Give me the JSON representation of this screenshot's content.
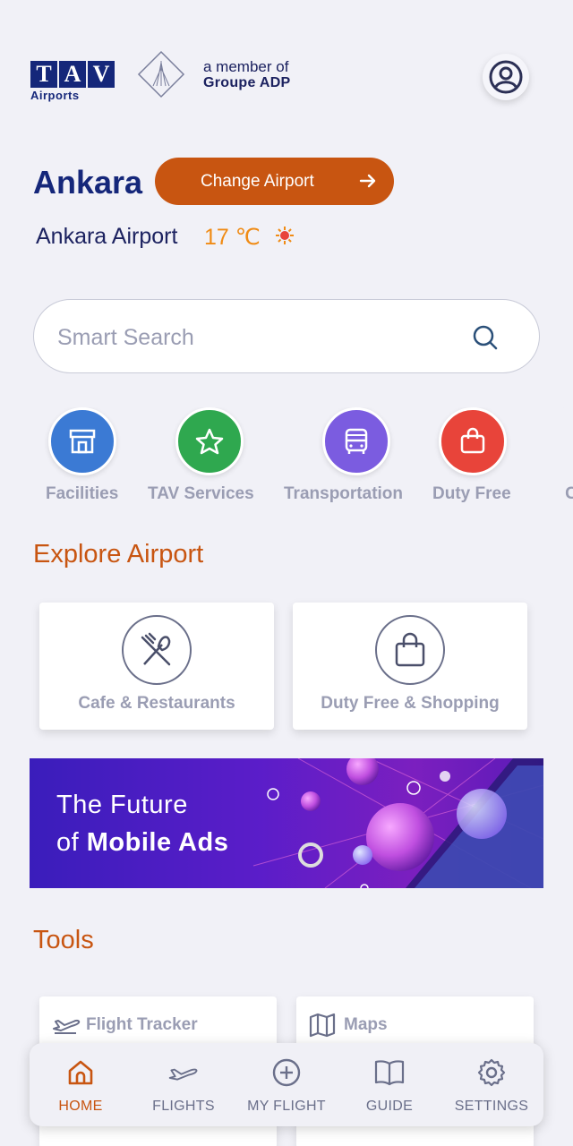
{
  "header": {
    "logo_letters": [
      "T",
      "A",
      "V"
    ],
    "logo_sub": "Airports",
    "member_line1": "a member of",
    "member_line2": "Groupe ADP"
  },
  "location": {
    "city": "Ankara",
    "change_label": "Change Airport",
    "airport": "Ankara Airport",
    "temperature": "17 ℃",
    "weather_icon": "sun-icon"
  },
  "search": {
    "placeholder": "Smart Search"
  },
  "categories": [
    {
      "label": "Facilities",
      "icon": "storefront-icon",
      "color": "#3b7ad4"
    },
    {
      "label": "TAV Services",
      "icon": "star-icon",
      "color": "#2fa84f"
    },
    {
      "label": "Transportation",
      "icon": "bus-icon",
      "color": "#7b5ce0"
    },
    {
      "label": "Duty Free",
      "icon": "shopping-bag-icon",
      "color": "#e8443a"
    },
    {
      "label": "C",
      "icon": "more-icon",
      "color": "#f1f1f7"
    }
  ],
  "explore": {
    "title": "Explore Airport",
    "cards": [
      {
        "label": "Cafe & Restaurants",
        "icon": "fork-knife-icon"
      },
      {
        "label": "Duty Free & Shopping",
        "icon": "shopping-bag-icon"
      }
    ]
  },
  "ad": {
    "line1": "The Future",
    "line2_prefix": "of",
    "line2_bold": "Mobile Ads"
  },
  "tools": {
    "title": "Tools",
    "cards": [
      {
        "label": "Flight Tracker",
        "icon": "plane-icon"
      },
      {
        "label": "Maps",
        "icon": "map-icon"
      }
    ]
  },
  "nav": {
    "items": [
      {
        "label": "HOME",
        "icon": "home-icon",
        "active": true
      },
      {
        "label": "FLIGHTS",
        "icon": "plane-icon"
      },
      {
        "label": "MY FLIGHT",
        "icon": "plus-circle-icon"
      },
      {
        "label": "GUIDE",
        "icon": "book-icon"
      },
      {
        "label": "SETTINGS",
        "icon": "gear-icon"
      }
    ]
  },
  "colors": {
    "accent": "#c85511",
    "navy": "#15277a",
    "temperature": "#f08b14",
    "muted": "#9a9db3"
  }
}
